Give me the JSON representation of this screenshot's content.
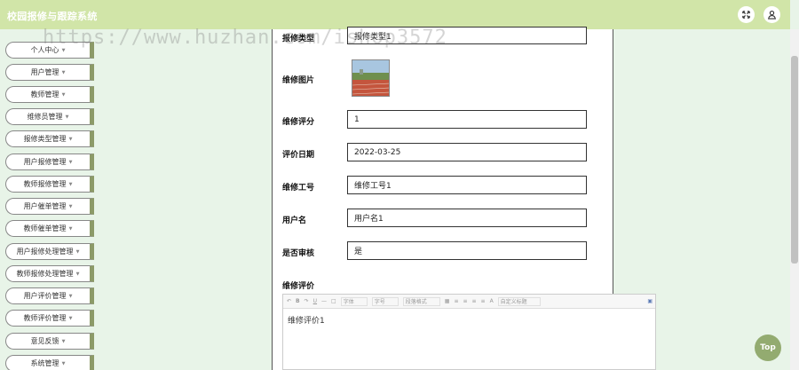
{
  "header": {
    "title": "校园报修与跟踪系统"
  },
  "watermark": "https://www.huzhan.com/ishop3572",
  "sidebar": {
    "items": [
      {
        "label": "个人中心"
      },
      {
        "label": "用户管理"
      },
      {
        "label": "教师管理"
      },
      {
        "label": "维修员管理"
      },
      {
        "label": "报修类型管理"
      },
      {
        "label": "用户报修管理"
      },
      {
        "label": "教师报修管理"
      },
      {
        "label": "用户催单管理"
      },
      {
        "label": "教师催单管理"
      },
      {
        "label": "用户报修处理管理"
      },
      {
        "label": "教师报修处理管理"
      },
      {
        "label": "用户评价管理"
      },
      {
        "label": "教师评价管理"
      },
      {
        "label": "意见反馈"
      },
      {
        "label": "系统管理"
      }
    ]
  },
  "form": {
    "repair_type": {
      "label": "报修类型",
      "value": "报修类型1"
    },
    "repair_image": {
      "label": "维修图片"
    },
    "score": {
      "label": "维修评分",
      "value": "1"
    },
    "eval_date": {
      "label": "评价日期",
      "value": "2022-03-25"
    },
    "worker_id": {
      "label": "维修工号",
      "value": "维修工号1"
    },
    "username": {
      "label": "用户名",
      "value": "用户名1"
    },
    "reviewed": {
      "label": "是否审核",
      "value": "是"
    },
    "evaluation": {
      "label": "维修评价",
      "value": "维修评价1"
    }
  },
  "editor": {
    "font": "字体",
    "size": "字号",
    "paragraph": "段落格式",
    "custom_title": "自定义标题"
  },
  "top_button": "Top"
}
